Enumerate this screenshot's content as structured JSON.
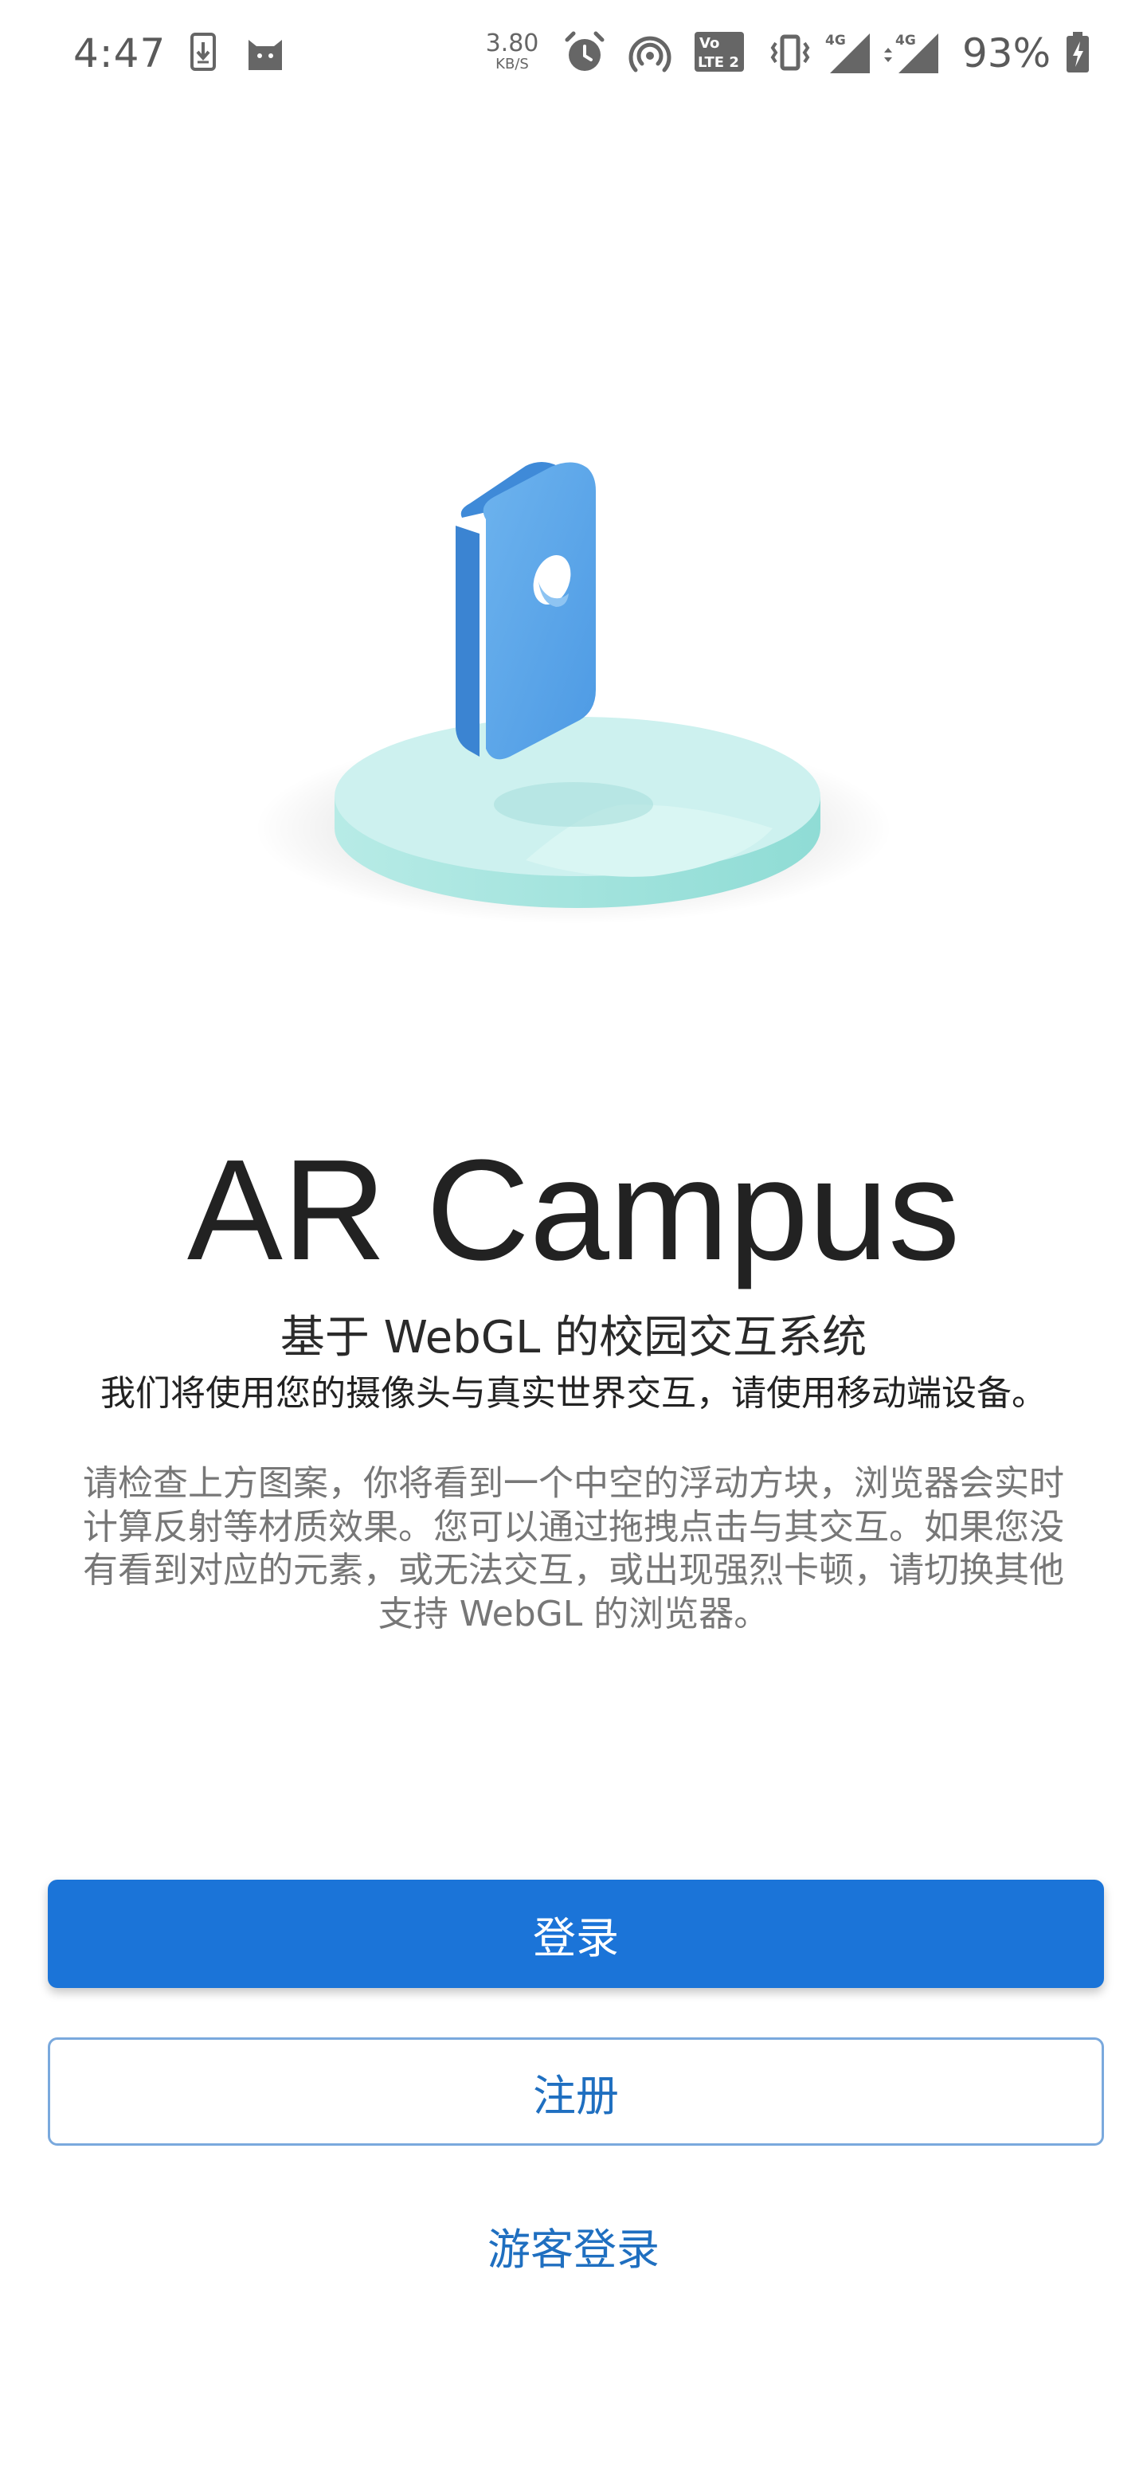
{
  "status_bar": {
    "time": "4:47",
    "net_speed_value": "3.80",
    "net_speed_unit": "KB/S",
    "battery_percent": "93%",
    "lte_label_top": "Vo",
    "lte_label_bottom": "LTE 2",
    "signal1_label": "4G",
    "signal2_label": "4G",
    "icons": [
      "download-notification-icon",
      "cat-app-icon",
      "alarm-icon",
      "hotspot-icon",
      "volte-icon",
      "vibrate-icon",
      "signal-4g-icon",
      "signal-4g-data-icon",
      "battery-charging-icon"
    ]
  },
  "illustration": {
    "description_icon": "floating-hollow-block-icon",
    "colors": {
      "block": "#5fa8ea",
      "block_side": "#3f8ad8",
      "platform_top": "#cdf1ef",
      "platform_side": "#9fe0db"
    }
  },
  "main": {
    "title": "AR Campus",
    "subtitle": "基于 WebGL 的校园交互系统",
    "tagline": "我们将使用您的摄像头与真实世界交互，请使用移动端设备。",
    "description_lines": [
      "请检查上方图案，你将看到一个中空的浮动方块，浏览器会实时",
      "计算反射等材质效果。您可以通过拖拽点击与其交互。如果您没",
      "有看到对应的元素，或无法交互，或出现强烈卡顿，请切换其他",
      "支持 WebGL 的浏览器。"
    ]
  },
  "actions": {
    "login_label": "登录",
    "register_label": "注册",
    "guest_label": "游客登录"
  },
  "colors": {
    "primary": "#1b74d8",
    "link": "#1f6fc0"
  }
}
